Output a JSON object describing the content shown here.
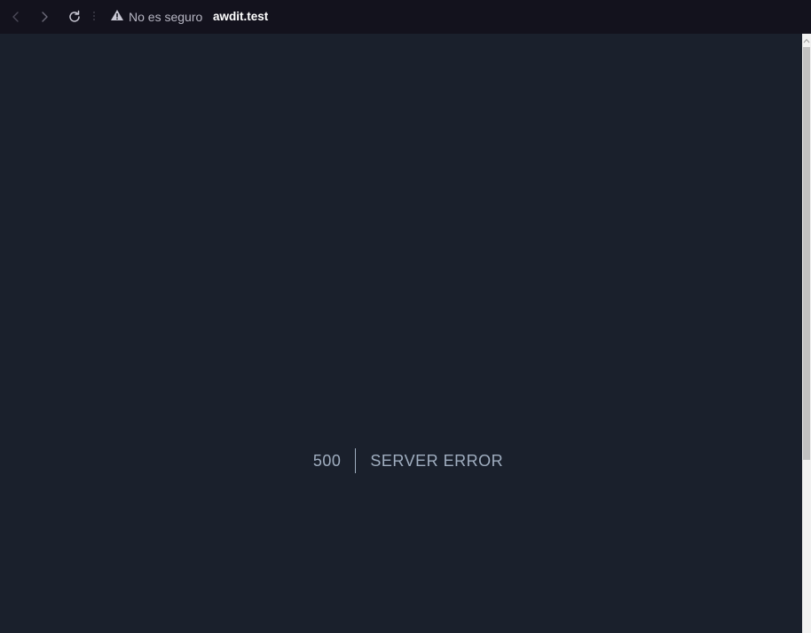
{
  "browser": {
    "security_label": "No es seguro",
    "url": "awdit.test",
    "icons": {
      "back": "chevron-left-icon",
      "forward": "chevron-right-icon",
      "reload": "reload-icon",
      "warning": "warning-triangle-icon"
    },
    "colors": {
      "toolbar_bg": "#13121d",
      "url_text": "#ffffff",
      "security_text": "#b7b6c3"
    }
  },
  "page": {
    "error_code": "500",
    "error_message": "SERVER ERROR",
    "colors": {
      "background": "#1a202c",
      "text": "#a0aec0"
    }
  }
}
